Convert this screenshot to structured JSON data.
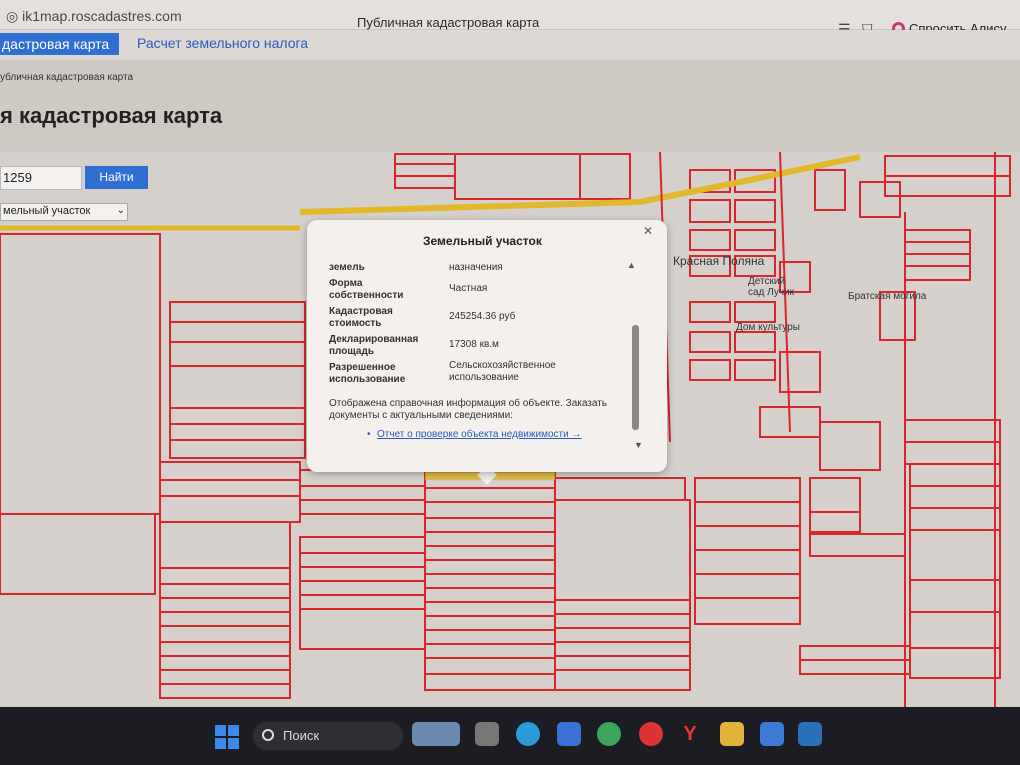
{
  "browser": {
    "url": "ik1map.roscadastres.com",
    "tab_title": "Публичная кадастровая карта",
    "alice_label": "Спросить Алису AI"
  },
  "site": {
    "nav_active": "дастровая карта",
    "nav_link": "Расчет земельного налога",
    "breadcrumb": "убличная кадастровая карта",
    "page_title": "я кадастровая карта"
  },
  "search": {
    "value": "1259",
    "button": "Найти",
    "type_value": "мельный участок"
  },
  "popup": {
    "title": "Земельный участок",
    "rows": [
      {
        "label": "земель",
        "value": "назначения"
      },
      {
        "label": "Форма собственности",
        "value": "Частная"
      },
      {
        "label": "Кадастровая стоимость",
        "value": "245254.36 руб"
      },
      {
        "label": "Декларированная площадь",
        "value": "17308 кв.м"
      },
      {
        "label": "Разрешенное использование",
        "value": "Сельскохозяйственное использование"
      }
    ],
    "note": "Отображена справочная информация об объекте. Заказать документы с актуальными сведениями:",
    "link": "Отчет о проверке объекта недвижимости →"
  },
  "map_labels": {
    "place": "Красная Поляна",
    "kindergarten": "Детский сад Лучик",
    "culture": "Дом культуры",
    "grave": "Братская могила"
  },
  "taskbar": {
    "search": "Поиск"
  }
}
